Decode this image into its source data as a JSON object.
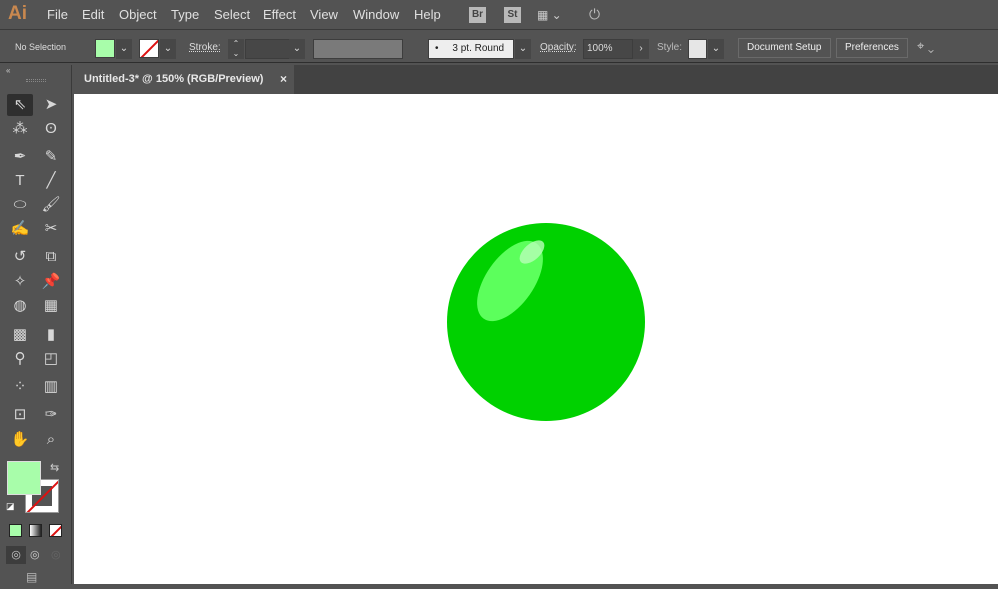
{
  "app": {
    "logo": "Ai"
  },
  "menu": [
    "File",
    "Edit",
    "Object",
    "Type",
    "Select",
    "Effect",
    "View",
    "Window",
    "Help"
  ],
  "menubar_icons": {
    "bridge": "Br",
    "stock": "St"
  },
  "control": {
    "selection": "No Selection",
    "stroke_label": "Stroke:",
    "brush": "3 pt. Round",
    "opacity_label": "Opacity:",
    "opacity_value": "100%",
    "style_label": "Style:",
    "document_setup": "Document Setup",
    "preferences": "Preferences"
  },
  "colors": {
    "fill": "#a8fdaa",
    "sphere": "#00d100",
    "highlight": "#5cff5c",
    "accent": "#c9884f"
  },
  "tab": {
    "title": "Untitled-3* @ 150% (RGB/Preview)",
    "close": "×"
  },
  "tools": [
    [
      "selection",
      "direct-selection"
    ],
    [
      "magic-wand",
      "lasso"
    ],
    [
      "pen",
      "curvature"
    ],
    [
      "type",
      "line-segment"
    ],
    [
      "ellipse",
      "paintbrush"
    ],
    [
      "shaper",
      "scissors"
    ],
    [
      "rotate",
      "scale"
    ],
    [
      "puppet-warp",
      "pin"
    ],
    [
      "shape-builder",
      "perspective-grid"
    ],
    [
      "mesh",
      "gradient"
    ],
    [
      "eyedropper",
      "blend"
    ],
    [
      "symbol-sprayer",
      "column-graph"
    ],
    [
      "artboard",
      "slice"
    ],
    [
      "hand",
      "zoom"
    ]
  ]
}
